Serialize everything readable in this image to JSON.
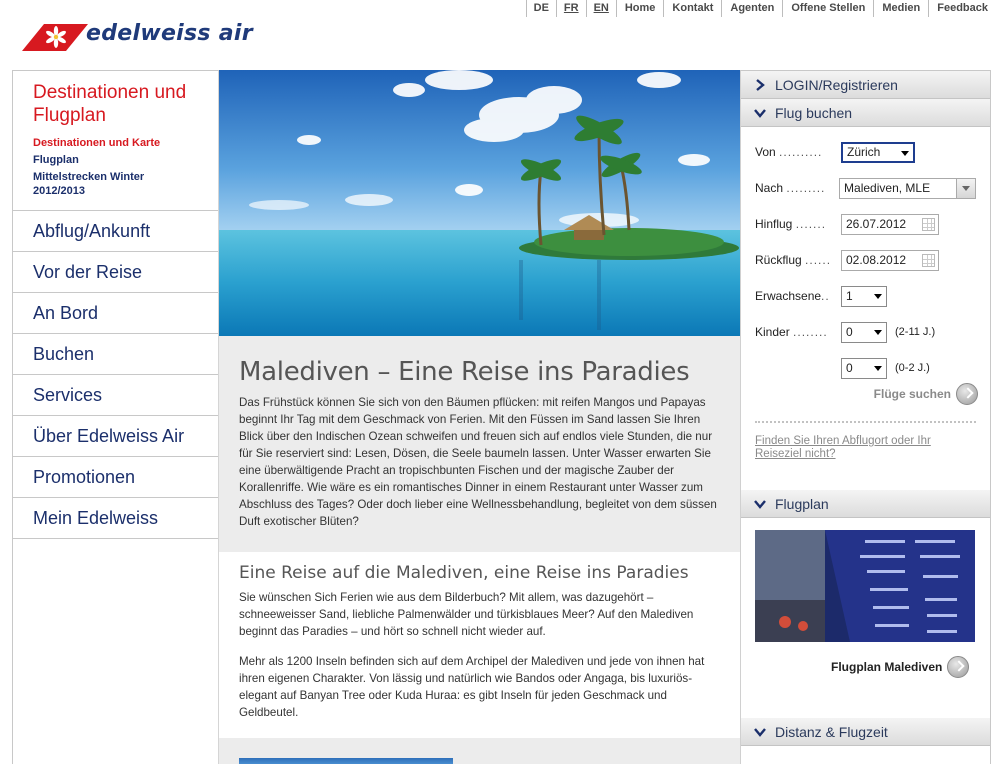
{
  "topnav": {
    "languages": [
      "DE",
      "FR",
      "EN"
    ],
    "links": [
      "Home",
      "Kontakt",
      "Agenten",
      "Offene Stellen",
      "Medien",
      "Feedback"
    ]
  },
  "brand": {
    "name": "edelweiss air",
    "red": "#d71920",
    "blue": "#1f3a7a"
  },
  "leftnav": {
    "active_title": "Destinationen und Flugplan",
    "subitems": [
      "Destinationen und Karte",
      "Flugplan",
      "Mittelstrecken Winter\n2012/2013"
    ],
    "items": [
      "Abflug/Ankunft",
      "Vor der Reise",
      "An Bord",
      "Buchen",
      "Services",
      "Über Edelweiss Air",
      "Promotionen",
      "Mein Edelweiss"
    ]
  },
  "main": {
    "title": "Malediven – Eine Reise ins Paradies",
    "intro": "Das Frühstück können Sie sich von den Bäumen pflücken: mit reifen Mangos und Papayas beginnt Ihr Tag mit dem Geschmack von Ferien. Mit den Füssen im Sand lassen Sie Ihren Blick über den Indischen Ozean schweifen und freuen sich auf endlos viele Stunden, die nur für Sie reserviert sind: Lesen, Dösen, die Seele baumeln lassen. Unter Wasser erwarten Sie eine überwältigende Pracht an tropischbunten Fischen und der magische Zauber der Korallenriffe. Wie wäre es ein romantisches Dinner in einem Restaurant unter Wasser zum Abschluss des Tages? Oder doch lieber eine Wellnessbehandlung, begleitet von dem süssen Duft exotischer Blüten?",
    "subtitle": "Eine Reise auf die Malediven, eine Reise ins Paradies",
    "para1": "Sie wünschen Sich Ferien wie aus dem Bilderbuch? Mit allem, was dazugehört – schneeweisser Sand, liebliche Palmenwälder und türkisblaues Meer? Auf den Malediven beginnt das Paradies – und hört so schnell nicht wieder auf.",
    "para2": "Mehr als 1200 Inseln befinden sich auf dem Archipel der Malediven und jede von ihnen hat ihren eigenen Charakter. Von lässig und natürlich wie Bandos oder Angaga, bis luxuriös-elegant auf Banyan Tree oder Kuda Huraa: es gibt Inseln für jeden Geschmack und Geldbeutel."
  },
  "right": {
    "login": "LOGIN/Registrieren",
    "booking": {
      "title": "Flug buchen",
      "von_label": "Von",
      "von_value": "Zürich",
      "nach_label": "Nach",
      "nach_value": "Malediven, MLE",
      "hinflug_label": "Hinflug",
      "hinflug_value": "26.07.2012",
      "rueckflug_label": "Rückflug",
      "rueckflug_value": "02.08.2012",
      "erwachsene_label": "Erwachsene",
      "erwachsene_value": "1",
      "kinder_label": "Kinder",
      "kinder_value": "0",
      "kinder_hint": "(2-11 J.)",
      "infant_value": "0",
      "infant_hint": "(0-2 J.)",
      "search": "Flüge suchen",
      "link": "Finden Sie Ihren Abflugort oder Ihr Reiseziel nicht?"
    },
    "flugplan": {
      "title": "Flugplan",
      "link": "Flugplan Malediven"
    },
    "distanz": {
      "title": "Distanz & Flugzeit"
    }
  }
}
